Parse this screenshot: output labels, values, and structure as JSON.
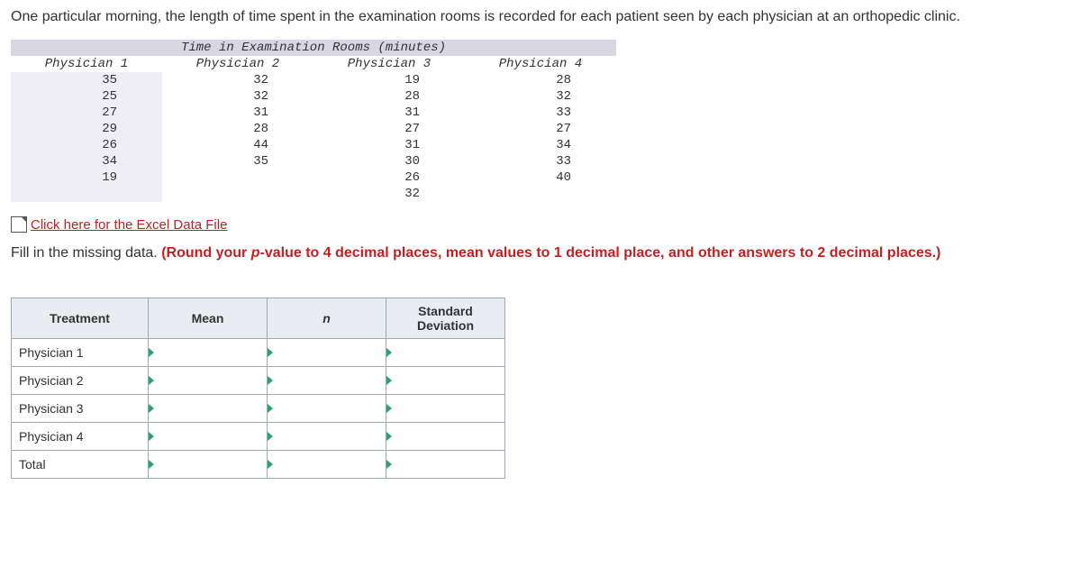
{
  "intro": "One particular morning, the length of time spent in the examination rooms is recorded for each patient seen by each physician at an orthopedic clinic.",
  "data_table": {
    "title": "Time in Examination Rooms (minutes)",
    "headers": [
      "Physician 1",
      "Physician 2",
      "Physician 3",
      "Physician 4"
    ],
    "rows": [
      [
        "35",
        "32",
        "19",
        "28"
      ],
      [
        "25",
        "32",
        "28",
        "32"
      ],
      [
        "27",
        "31",
        "31",
        "33"
      ],
      [
        "29",
        "28",
        "27",
        "27"
      ],
      [
        "26",
        "44",
        "31",
        "34"
      ],
      [
        "34",
        "35",
        "30",
        "33"
      ],
      [
        "19",
        "",
        "26",
        "40"
      ],
      [
        "",
        "",
        "32",
        ""
      ]
    ]
  },
  "excel_link_label": " Click here for the Excel Data File",
  "fill_prefix": "Fill in the missing data. ",
  "fill_hl_a": "(Round your ",
  "fill_hl_p": "p",
  "fill_hl_b": "-value to 4 decimal places, mean values to 1 decimal place, and other answers to 2 decimal places.)",
  "answer_table": {
    "headers": [
      "Treatment",
      "Mean",
      "n",
      "Standard Deviation"
    ],
    "rows": [
      "Physician 1",
      "Physician 2",
      "Physician 3",
      "Physician 4",
      "Total"
    ]
  }
}
